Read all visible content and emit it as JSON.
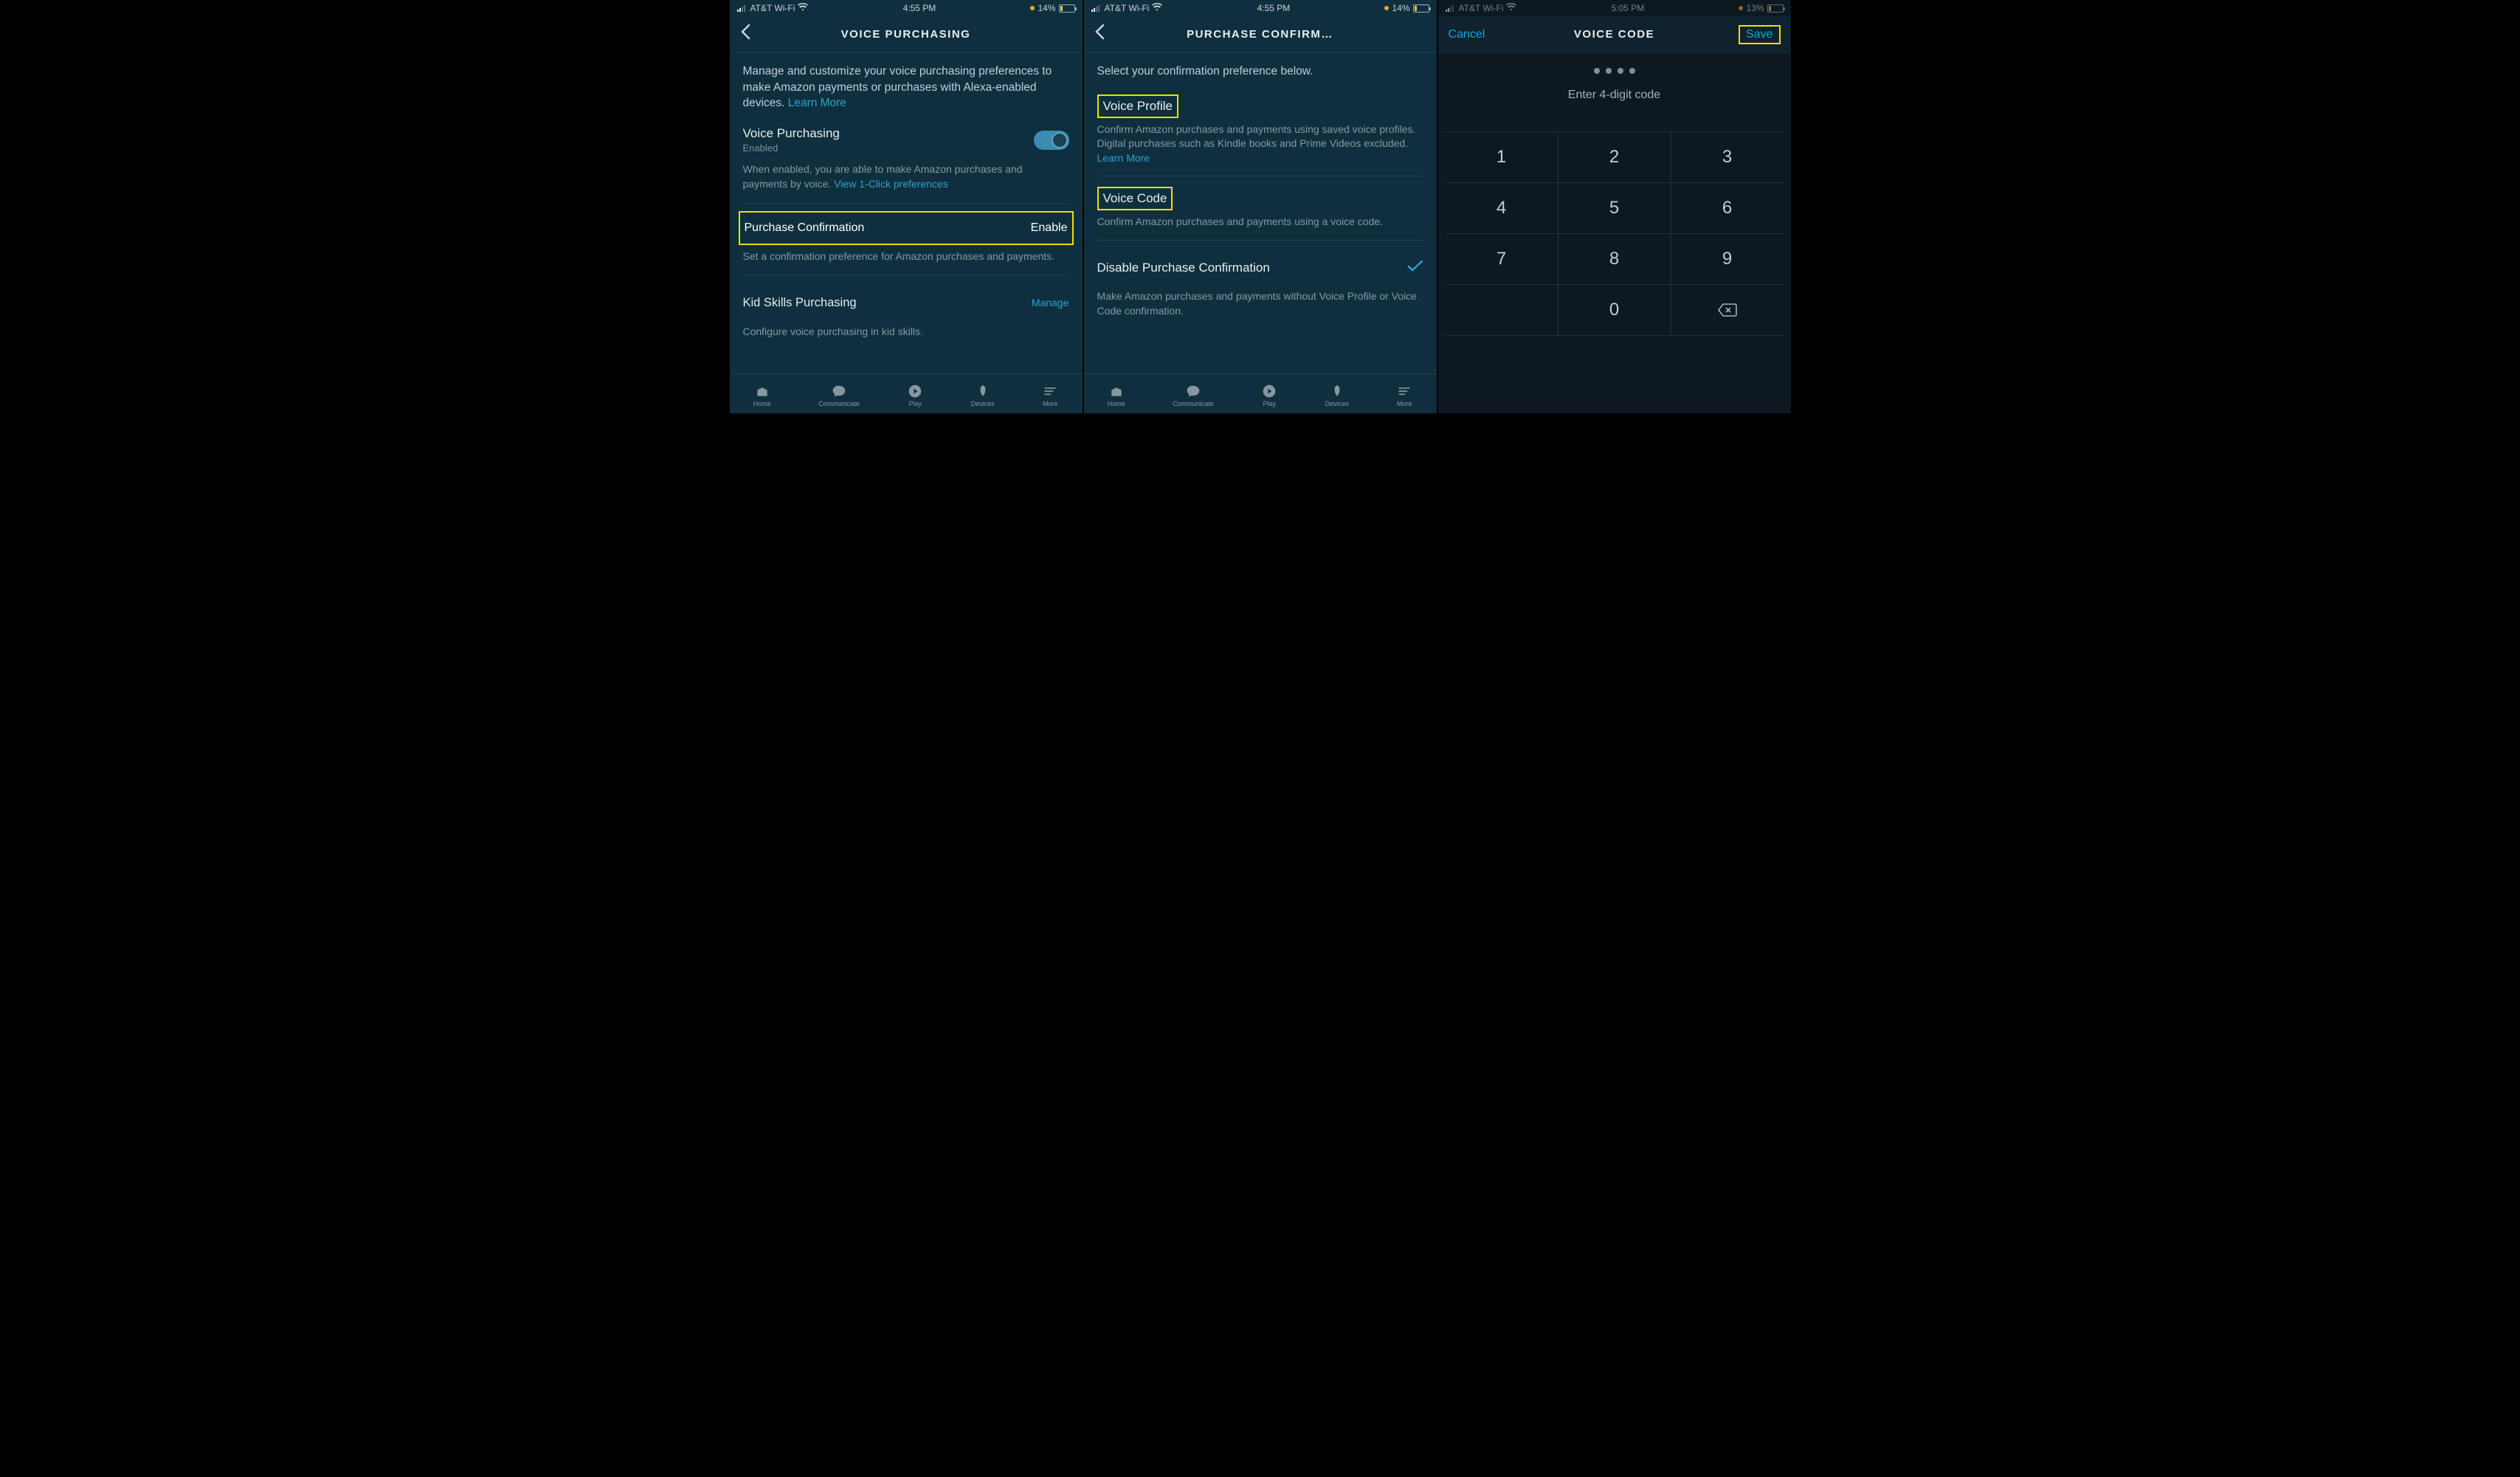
{
  "statusbar": {
    "carrier": "AT&T Wi-Fi",
    "time1": "4:55 PM",
    "time2": "4:55 PM",
    "time3": "5:05 PM",
    "battery1": "14%",
    "battery2": "14%",
    "battery3": "13%"
  },
  "screen1": {
    "title": "VOICE PURCHASING",
    "description_pre": "Manage and customize your voice purchasing preferences to make Amazon payments or purchases with Alexa-enabled devices. ",
    "description_link": "Learn More",
    "voice_purchasing": {
      "label": "Voice Purchasing",
      "status": "Enabled"
    },
    "vp_hint_pre": "When enabled, you are able to make Amazon purchases and payments by voice. ",
    "vp_hint_link": "View 1-Click preferences",
    "purchase_confirmation": {
      "label": "Purchase Confirmation",
      "action": "Enable"
    },
    "pc_hint": "Set a confirmation preference for Amazon purchases and payments.",
    "kid_skills": {
      "label": "Kid Skills Purchasing",
      "action": "Manage"
    },
    "ks_hint": "Configure voice purchasing in kid skills."
  },
  "screen2": {
    "title": "PURCHASE CONFIRM…",
    "description": "Select your confirmation preference below.",
    "voice_profile": {
      "label": "Voice Profile"
    },
    "vp_hint_pre": "Confirm Amazon purchases and payments using saved voice profiles. Digital purchases such as Kindle books and Prime Videos excluded. ",
    "vp_hint_link": "Learn More",
    "voice_code": {
      "label": "Voice Code"
    },
    "vc_hint": "Confirm Amazon purchases and payments using a voice code.",
    "disable": {
      "label": "Disable Purchase Confirmation"
    },
    "disable_hint": "Make Amazon purchases and payments without Voice Profile or Voice Code confirmation."
  },
  "screen3": {
    "title": "VOICE CODE",
    "cancel": "Cancel",
    "save": "Save",
    "prompt": "Enter 4-digit code",
    "keys": [
      [
        "1",
        "2",
        "3"
      ],
      [
        "4",
        "5",
        "6"
      ],
      [
        "7",
        "8",
        "9"
      ],
      [
        "",
        "0",
        "⌫"
      ]
    ]
  },
  "tabs": [
    {
      "label": "Home"
    },
    {
      "label": "Communicate"
    },
    {
      "label": "Play"
    },
    {
      "label": "Devices"
    },
    {
      "label": "More"
    }
  ]
}
